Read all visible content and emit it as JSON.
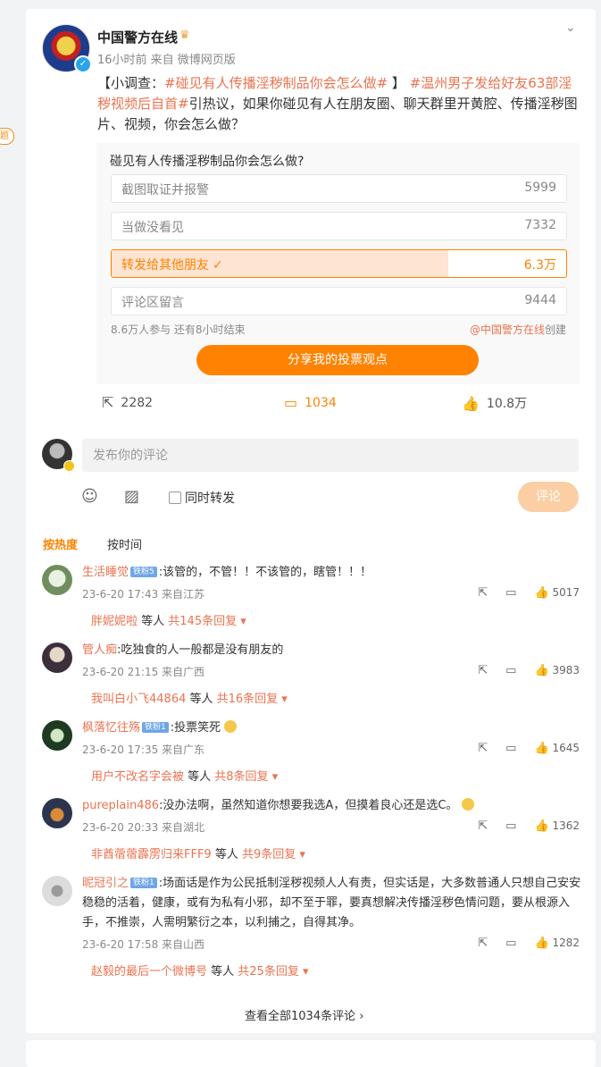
{
  "left_badge": "题",
  "post": {
    "username": "中国警方在线",
    "meta": "16小时前  来自 微博网页版",
    "text_prefix": "【小调查：",
    "tag1": "#碰见有人传播淫秽制品你会怎么做#",
    "text_mid": " 】 ",
    "tag2": "#温州男子发给好友63部淫秽视频后自首#",
    "text_suffix": "引热议，如果你碰见有人在朋友圈、聊天群里开黄腔、传播淫秽图片、视频，你会怎么做？"
  },
  "vote": {
    "question": "碰见有人传播淫秽制品你会怎么做?",
    "options": [
      {
        "label": "截图取证并报警",
        "count": "5999"
      },
      {
        "label": "当做没看见",
        "count": "7332"
      },
      {
        "label": "转发给其他朋友",
        "count": "6.3万",
        "selected": true,
        "share": 0.74
      },
      {
        "label": "评论区留言",
        "count": "9444"
      }
    ],
    "participants": "8.6万人参与 还有8小时结束",
    "creator": "@中国警方在线",
    "creator_suffix": "创建",
    "share_button": "分享我的投票观点"
  },
  "actions": {
    "repost": "2282",
    "comment": "1034",
    "like": "10.8万"
  },
  "compose": {
    "placeholder": "发布你的评论",
    "repost_label": "同时转发",
    "submit": "评论"
  },
  "sort": {
    "hot": "按热度",
    "time": "按时间"
  },
  "comments": [
    {
      "name": "生活睡觉",
      "badge": "铁粉5",
      "text": ":该管的，不管！！不该管的，瞎管！！！",
      "time": "23-6-20 17:43 来自江苏",
      "likes": "5017",
      "reply_name": "胖妮妮啦",
      "reply_mid": " 等人 ",
      "reply_count": "共145条回复"
    },
    {
      "name": "管人痴",
      "badge": "",
      "text": ":吃独食的人一般都是没有朋友的",
      "time": "23-6-20 21:15 来自广西",
      "likes": "3983",
      "reply_name": "我叫白小飞44864",
      "reply_mid": " 等人 ",
      "reply_count": "共16条回复"
    },
    {
      "name": "枫落忆往殇",
      "badge": "铁粉1",
      "text": ":投票笑死",
      "time": "23-6-20 17:35 来自广东",
      "likes": "1645",
      "reply_name": "用户不改名字会被",
      "reply_mid": " 等人 ",
      "reply_count": "共8条回复"
    },
    {
      "name": "pureplain486",
      "badge": "",
      "text": ":没办法啊，虽然知道你想要我选A，但摸着良心还是选C。",
      "time": "23-6-20 20:33 来自湖北",
      "likes": "1362",
      "reply_name": "非酋蓿蓿霹雳归来FFF9",
      "reply_mid": " 等人 ",
      "reply_count": "共9条回复"
    },
    {
      "name": "昵冠引之",
      "badge": "铁粉1",
      "text": ":场面话是作为公民抵制淫秽视频人人有责，但实话是，大多数普通人只想自己安安稳稳的活着，健康，或有为私有小邪，却不至于罪，要真想解决传播淫秽色情问题，要从根源入手，不推崇，人需明繁衍之本，以利捕之，自得其净。",
      "time": "23-6-20 17:58 来自山西",
      "likes": "1282",
      "reply_name": "赵毅的最后一个微博号",
      "reply_mid": " 等人 ",
      "reply_count": "共25条回复"
    }
  ],
  "view_all": "查看全部1034条评论",
  "colors": {
    "accent": "#ff8200",
    "link": "#eb7350",
    "vote_fill": "#fde4d3"
  }
}
